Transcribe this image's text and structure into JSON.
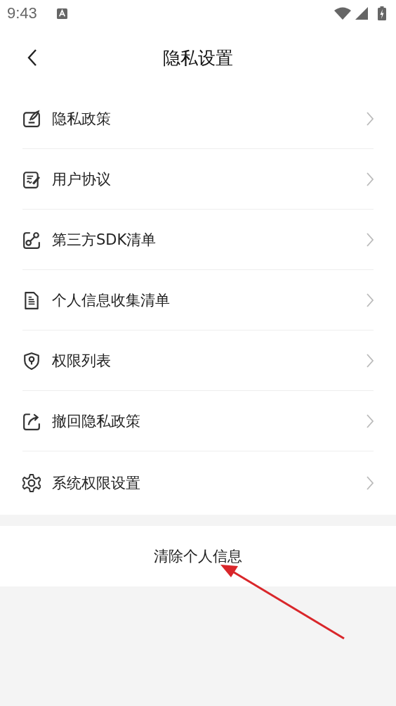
{
  "status_bar": {
    "time": "9:43"
  },
  "header": {
    "title": "隐私设置"
  },
  "items": [
    {
      "kind": "note",
      "label": "隐私政策"
    },
    {
      "kind": "contract",
      "label": "用户协议"
    },
    {
      "kind": "link",
      "label": "第三方SDK清单"
    },
    {
      "kind": "document",
      "label": "个人信息收集清单"
    },
    {
      "kind": "shield",
      "label": "权限列表"
    },
    {
      "kind": "export",
      "label": "撤回隐私政策"
    },
    {
      "kind": "gear",
      "label": "系统权限设置"
    }
  ],
  "clear_button": {
    "label": "清除个人信息"
  },
  "annotation": {
    "kind": "arrow"
  }
}
